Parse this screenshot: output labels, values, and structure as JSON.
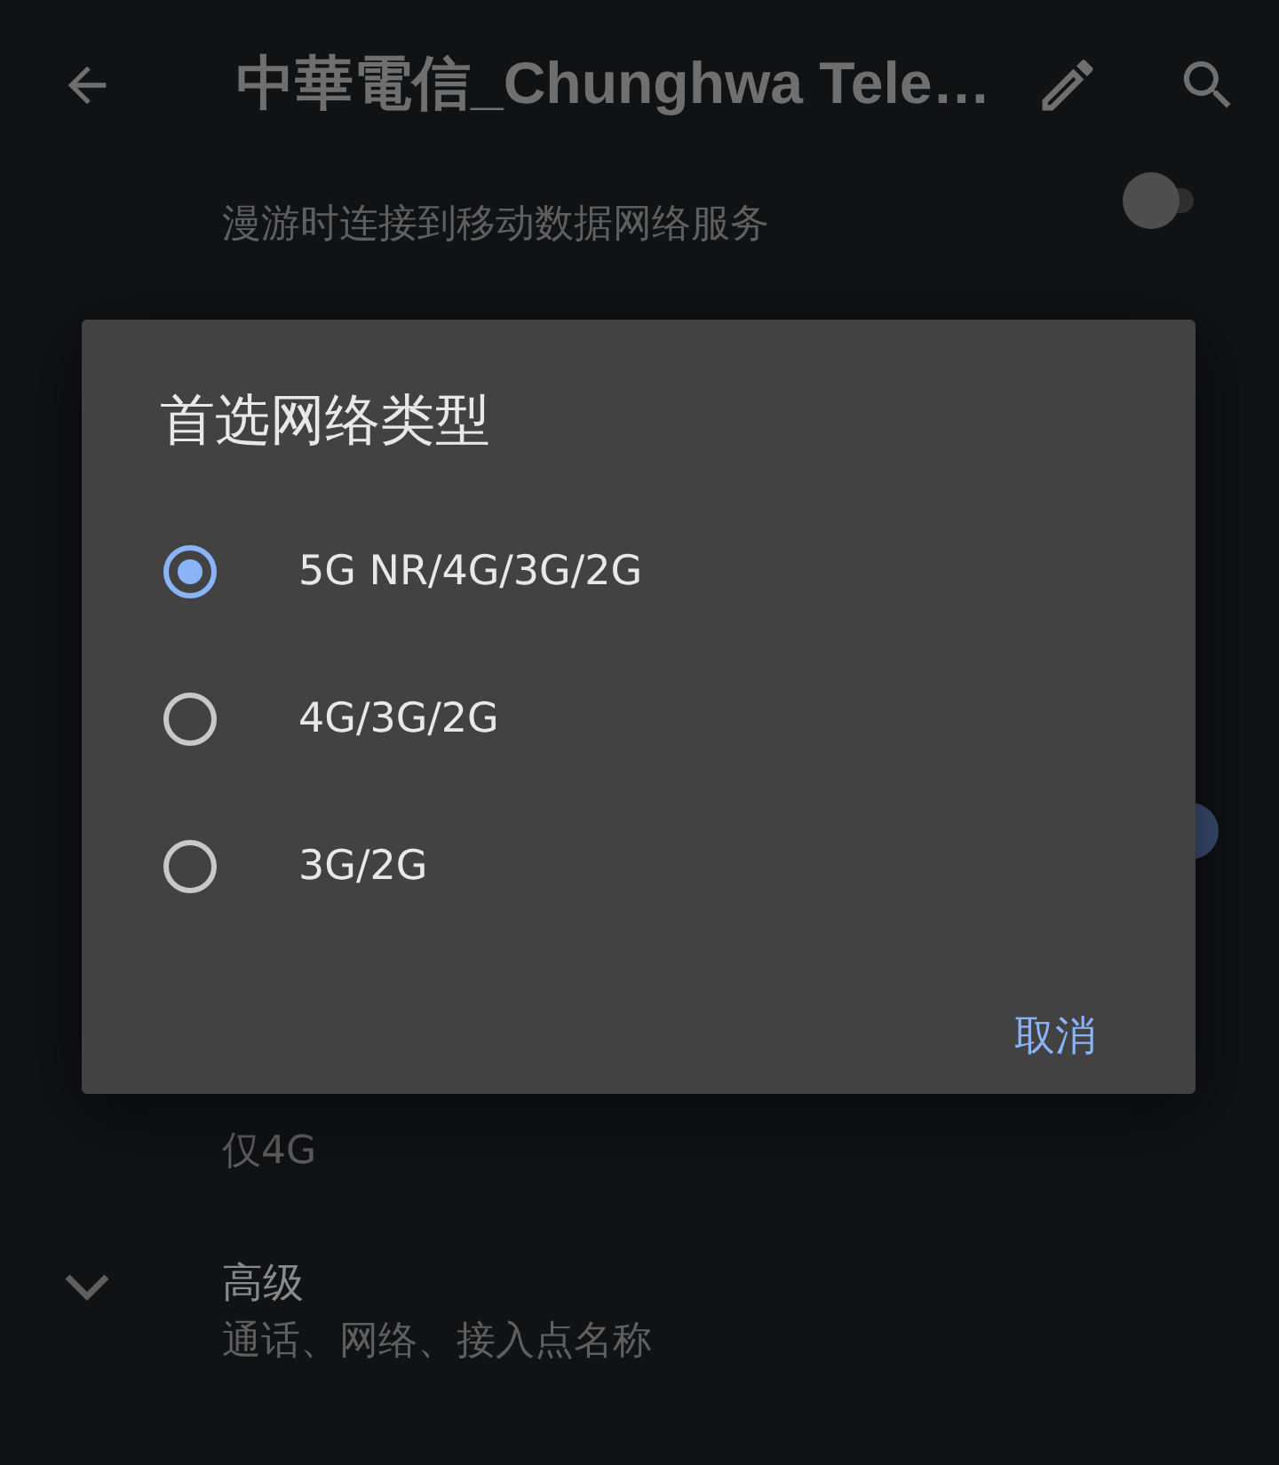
{
  "app_bar": {
    "title": "中華電信_Chunghwa Tele…"
  },
  "settings": [
    {
      "kind": "toggle",
      "subtitle": "漫游时连接到移动数据网络服务",
      "on": false
    },
    {
      "kind": "hidden-toggle",
      "on": true
    },
    {
      "kind": "text",
      "subtitle": "仅4G"
    },
    {
      "kind": "expand",
      "title": "高级",
      "subtitle": "通话、网络、接入点名称"
    }
  ],
  "dialog": {
    "title": "首选网络类型",
    "options": [
      {
        "label": "5G NR/4G/3G/2G",
        "selected": true
      },
      {
        "label": "4G/3G/2G",
        "selected": false
      },
      {
        "label": "3G/2G",
        "selected": false
      }
    ],
    "cancel": "取消"
  }
}
